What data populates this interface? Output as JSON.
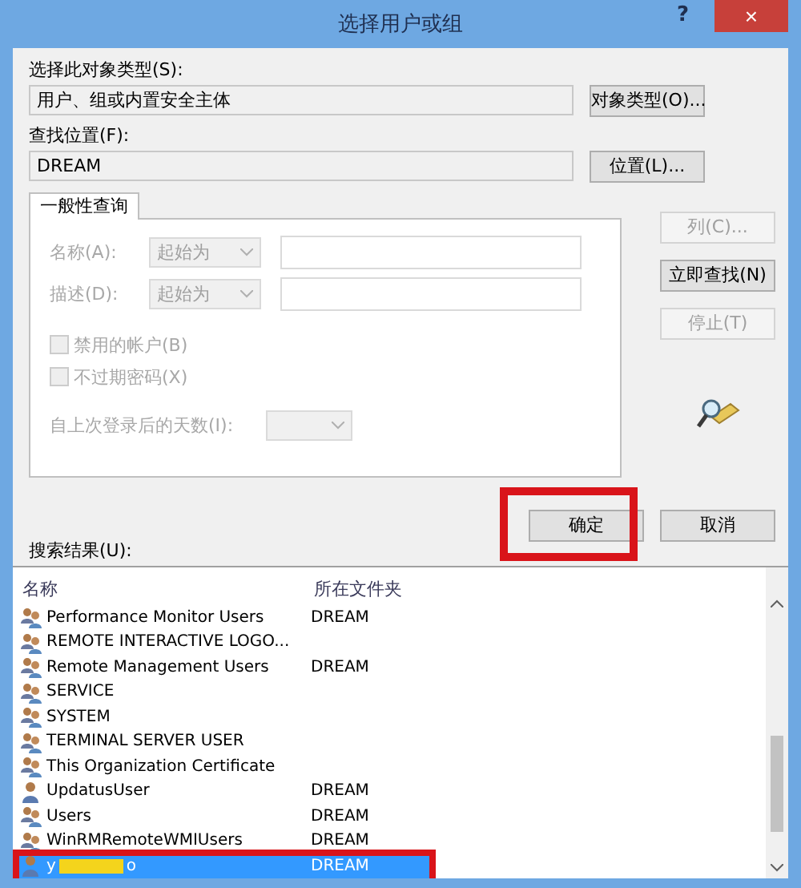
{
  "window": {
    "title": "选择用户或组",
    "help": "?",
    "close": "×"
  },
  "object_type": {
    "label": "选择此对象类型(S):",
    "value": "用户、组或内置安全主体",
    "button": "对象类型(O)..."
  },
  "location": {
    "label": "查找位置(F):",
    "value": "DREAM",
    "button": "位置(L)..."
  },
  "tabs": [
    {
      "label": "一般性查询",
      "selected": true
    }
  ],
  "query": {
    "fields": [
      {
        "label": "名称(A):",
        "mode": "起始为"
      },
      {
        "label": "描述(D):",
        "mode": "起始为"
      }
    ],
    "checkboxes": [
      {
        "label": "禁用的帐户(B)",
        "checked": false,
        "disabled": true
      },
      {
        "label": "不过期密码(X)",
        "checked": false,
        "disabled": true
      }
    ],
    "days_label": "自上次登录后的天数(I):"
  },
  "side_buttons": [
    {
      "label": "列(C)...",
      "disabled": true
    },
    {
      "label": "立即查找(N)",
      "disabled": false
    },
    {
      "label": "停止(T)",
      "disabled": true
    }
  ],
  "ok_button": {
    "label": "确定",
    "highlighted": true
  },
  "cancel_button": {
    "label": "取消"
  },
  "results": {
    "label": "搜索结果(U):",
    "columns": [
      "名称",
      "所在文件夹"
    ],
    "rows": [
      {
        "kind": "group",
        "name": "Performance Monitor Users",
        "folder": "DREAM",
        "selected": false
      },
      {
        "kind": "group",
        "name": "REMOTE INTERACTIVE LOGO...",
        "selected": false
      },
      {
        "kind": "group",
        "name": "Remote Management Users",
        "folder": "DREAM",
        "selected": false
      },
      {
        "kind": "group",
        "name": "SERVICE",
        "selected": false
      },
      {
        "kind": "group",
        "name": "SYSTEM",
        "selected": false
      },
      {
        "kind": "group",
        "name": "TERMINAL SERVER USER",
        "selected": false
      },
      {
        "kind": "group",
        "name": "This Organization Certificate",
        "selected": false
      },
      {
        "kind": "user",
        "name": "UpdatusUser",
        "folder": "DREAM",
        "selected": false
      },
      {
        "kind": "group",
        "name": "Users",
        "folder": "DREAM",
        "selected": false
      },
      {
        "kind": "group",
        "name": "WinRMRemoteWMIUsers",
        "folder": "DREAM",
        "selected": false
      },
      {
        "kind": "user",
        "name": "y",
        "name_end": "o",
        "redacted": true,
        "folder": "DREAM",
        "selected": true,
        "highlighted": true
      }
    ]
  }
}
